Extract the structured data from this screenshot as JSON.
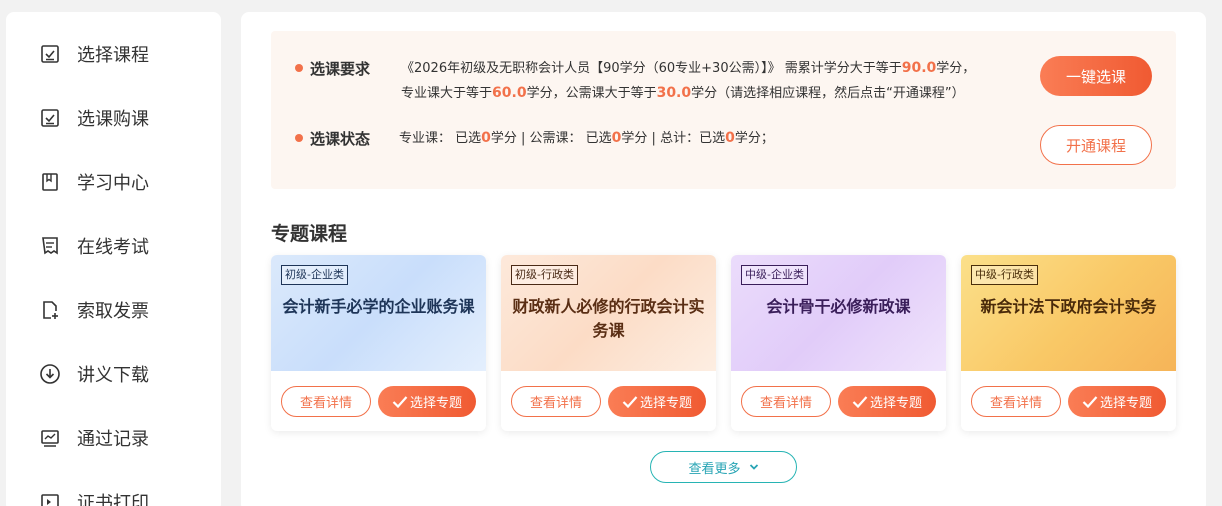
{
  "sidebar": {
    "items": [
      {
        "label": "选择课程",
        "icon": "checkbox-icon"
      },
      {
        "label": "选课购课",
        "icon": "checkbox-icon"
      },
      {
        "label": "学习中心",
        "icon": "bookmark-icon"
      },
      {
        "label": "在线考试",
        "icon": "exam-icon"
      },
      {
        "label": "索取发票",
        "icon": "invoice-add-icon"
      },
      {
        "label": "讲义下载",
        "icon": "download-icon"
      },
      {
        "label": "通过记录",
        "icon": "chart-record-icon"
      },
      {
        "label": "证书打印",
        "icon": "print-icon"
      }
    ]
  },
  "requirements": {
    "req_label": "选课要求",
    "req_line1_a": "《2026年初级及无职称会计人员【90学分（60专业+30公需）】》 需累计学分大于等于",
    "req_line1_total": "90.0",
    "req_line1_b": "学分，",
    "req_line2_a": "专业课大于等于",
    "req_line2_major": "60.0",
    "req_line2_b": "学分，公需课大于等于",
    "req_line2_public": "30.0",
    "req_line2_c": "学分（请选择相应课程，然后点击“开通课程”）",
    "status_label": "选课状态",
    "status_a": "专业课：  已选",
    "status_major": "0",
    "status_b": "学分 | 公需课：  已选",
    "status_public": "0",
    "status_c": "学分 | 总计：已选",
    "status_total": "0",
    "status_d": "学分；",
    "one_click_label": "一键选课",
    "open_course_label": "开通课程"
  },
  "section_title": "专题课程",
  "cards": [
    {
      "tag": "初级-企业类",
      "title": "会计新手必学的企业账务课",
      "detail_label": "查看详情",
      "select_label": "选择专题"
    },
    {
      "tag": "初级-行政类",
      "title": "财政新人必修的行政会计实务课",
      "detail_label": "查看详情",
      "select_label": "选择专题"
    },
    {
      "tag": "中级-企业类",
      "title": "会计骨干必修新政课",
      "detail_label": "查看详情",
      "select_label": "选择专题"
    },
    {
      "tag": "中级-行政类",
      "title": "新会计法下政府会计实务",
      "detail_label": "查看详情",
      "select_label": "选择专题"
    }
  ],
  "more_label": "查看更多",
  "colors": {
    "accent": "#f2714a",
    "teal": "#27b4b4",
    "req_bg": "#fdf6f1"
  }
}
